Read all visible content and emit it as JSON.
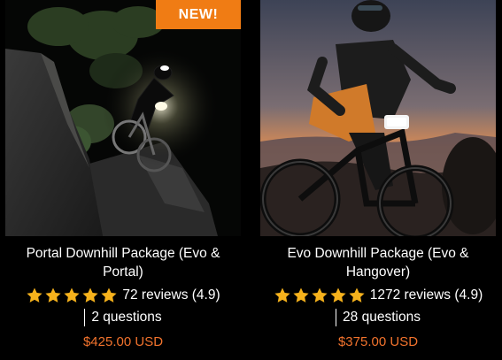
{
  "colors": {
    "accent": "#f07c14",
    "price": "#f2732d",
    "star": "#f6b21c",
    "background": "#000000"
  },
  "products": [
    {
      "badge": "NEW!",
      "image_icon": "night-downhill-rider-photo",
      "title_line1": "Portal Downhill Package (Evo &",
      "title_line2": "Portal)",
      "rating_stars": 5,
      "reviews": "72 reviews (4.9)",
      "questions": "2 questions",
      "price": "$425.00 USD"
    },
    {
      "image_icon": "sunset-rider-photo",
      "title_line1": "Evo Downhill Package (Evo &",
      "title_line2": "Hangover)",
      "rating_stars": 5,
      "reviews": "1272 reviews (4.9)",
      "questions": "28 questions",
      "price": "$375.00 USD"
    }
  ]
}
